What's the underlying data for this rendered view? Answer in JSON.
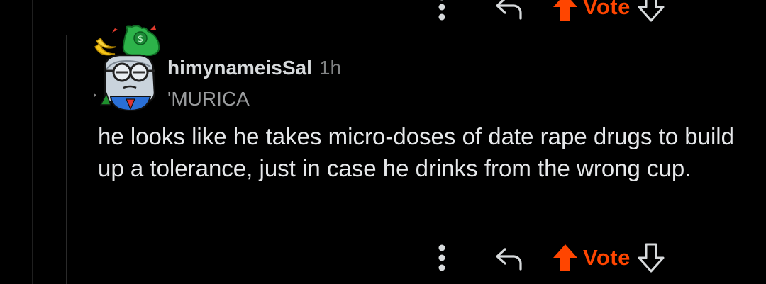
{
  "comment": {
    "username": "himynameisSal",
    "timestamp": "1h",
    "flair": "'MURICA",
    "body": "he looks like he takes micro-doses of date rape drugs to build up a tolerance, just in case he drinks from the wrong cup."
  },
  "actions": {
    "vote_label": "Vote"
  },
  "icons": {
    "more": "more-vertical-icon",
    "reply": "reply-icon",
    "upvote": "upvote-arrow-icon",
    "downvote": "downvote-arrow-icon",
    "avatar": "snoo-avatar-icon"
  },
  "colors": {
    "background": "#000000",
    "accent": "#ff4500",
    "text": "#d7dadc",
    "muted": "#818384"
  }
}
